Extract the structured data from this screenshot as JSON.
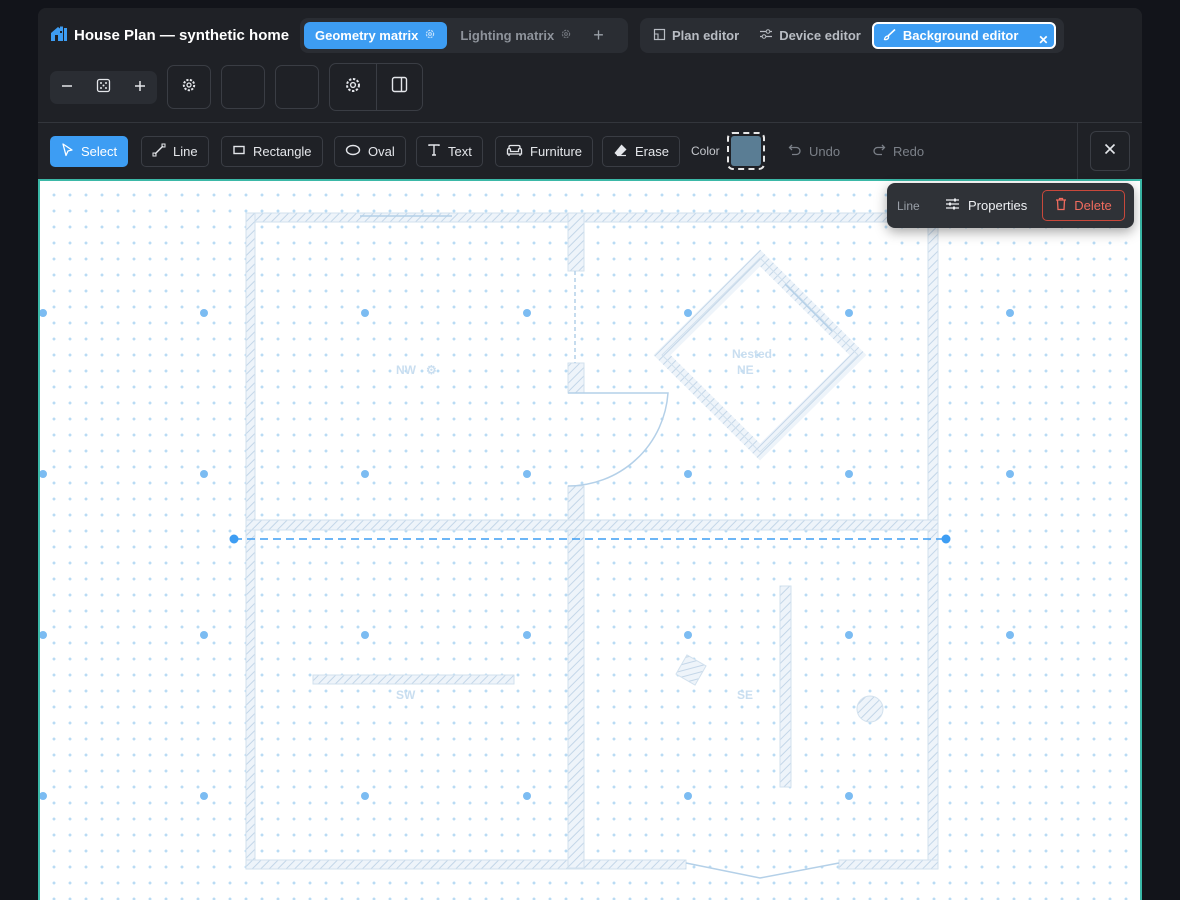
{
  "app": {
    "title": "House Plan — synthetic home"
  },
  "matrix_tabs": [
    {
      "label": "Geometry matrix",
      "active": true
    },
    {
      "label": "Lighting matrix",
      "active": false
    }
  ],
  "editor_tabs": [
    {
      "label": "Plan editor",
      "icon": "plan-icon"
    },
    {
      "label": "Device editor",
      "icon": "sliders-icon"
    },
    {
      "label": "Background editor",
      "icon": "brush-icon",
      "active": true
    }
  ],
  "toolbar": {
    "tools": [
      {
        "label": "Select",
        "icon": "cursor-icon",
        "active": true
      },
      {
        "label": "Line",
        "icon": "line-icon"
      },
      {
        "label": "Rectangle",
        "icon": "rectangle-icon"
      },
      {
        "label": "Oval",
        "icon": "oval-icon"
      },
      {
        "label": "Text",
        "icon": "text-icon"
      },
      {
        "label": "Furniture",
        "icon": "sofa-icon"
      },
      {
        "label": "Erase",
        "icon": "eraser-icon"
      }
    ],
    "color_label": "Color",
    "color_value": "#5a7d94",
    "undo_label": "Undo",
    "redo_label": "Redo"
  },
  "context_menu": {
    "selection_type": "Line",
    "properties_label": "Properties",
    "delete_label": "Delete"
  },
  "rooms": [
    "NW",
    "NE",
    "Nested",
    "SW",
    "SE"
  ],
  "colors": {
    "accent": "#3d9df3",
    "danger": "#f06b5e",
    "canvas_border": "#3bb8a7"
  }
}
